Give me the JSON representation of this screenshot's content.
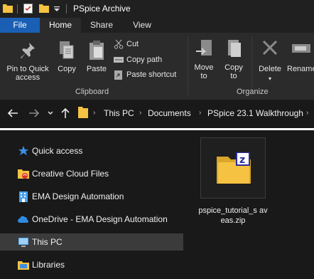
{
  "window": {
    "title": "PSpice Archive"
  },
  "tabs": {
    "file": "File",
    "home": "Home",
    "share": "Share",
    "view": "View"
  },
  "ribbon": {
    "pin_label": "Pin to Quick access",
    "copy_label": "Copy",
    "paste_label": "Paste",
    "cut_label": "Cut",
    "copy_path_label": "Copy path",
    "paste_shortcut_label": "Paste shortcut",
    "clipboard_group": "Clipboard",
    "move_to_label": "Move to",
    "copy_to_label": "Copy to",
    "delete_label": "Delete",
    "rename_label": "Rename",
    "organize_group": "Organize"
  },
  "address": {
    "crumbs": [
      "This PC",
      "Documents",
      "PSpice 23.1 Walkthrough"
    ]
  },
  "nav": {
    "items": [
      {
        "label": "Quick access",
        "icon": "star-icon"
      },
      {
        "label": "Creative Cloud Files",
        "icon": "creative-cloud-folder-icon"
      },
      {
        "label": "EMA Design Automation",
        "icon": "building-icon"
      },
      {
        "label": "OneDrive - EMA Design Automation",
        "icon": "onedrive-cloud-icon"
      },
      {
        "label": "This PC",
        "icon": "computer-icon"
      },
      {
        "label": "Libraries",
        "icon": "libraries-folder-icon"
      }
    ]
  },
  "content": {
    "files": [
      {
        "name": "pspice_tutorial_saveas.zip",
        "name_display": "pspice_tutorial_s aveas.zip",
        "icon": "zip-folder-icon"
      }
    ]
  },
  "colors": {
    "accent": "#1a5fb4",
    "background": "#191919",
    "ribbon": "#2b2b2b",
    "folder": "#f5c242"
  }
}
